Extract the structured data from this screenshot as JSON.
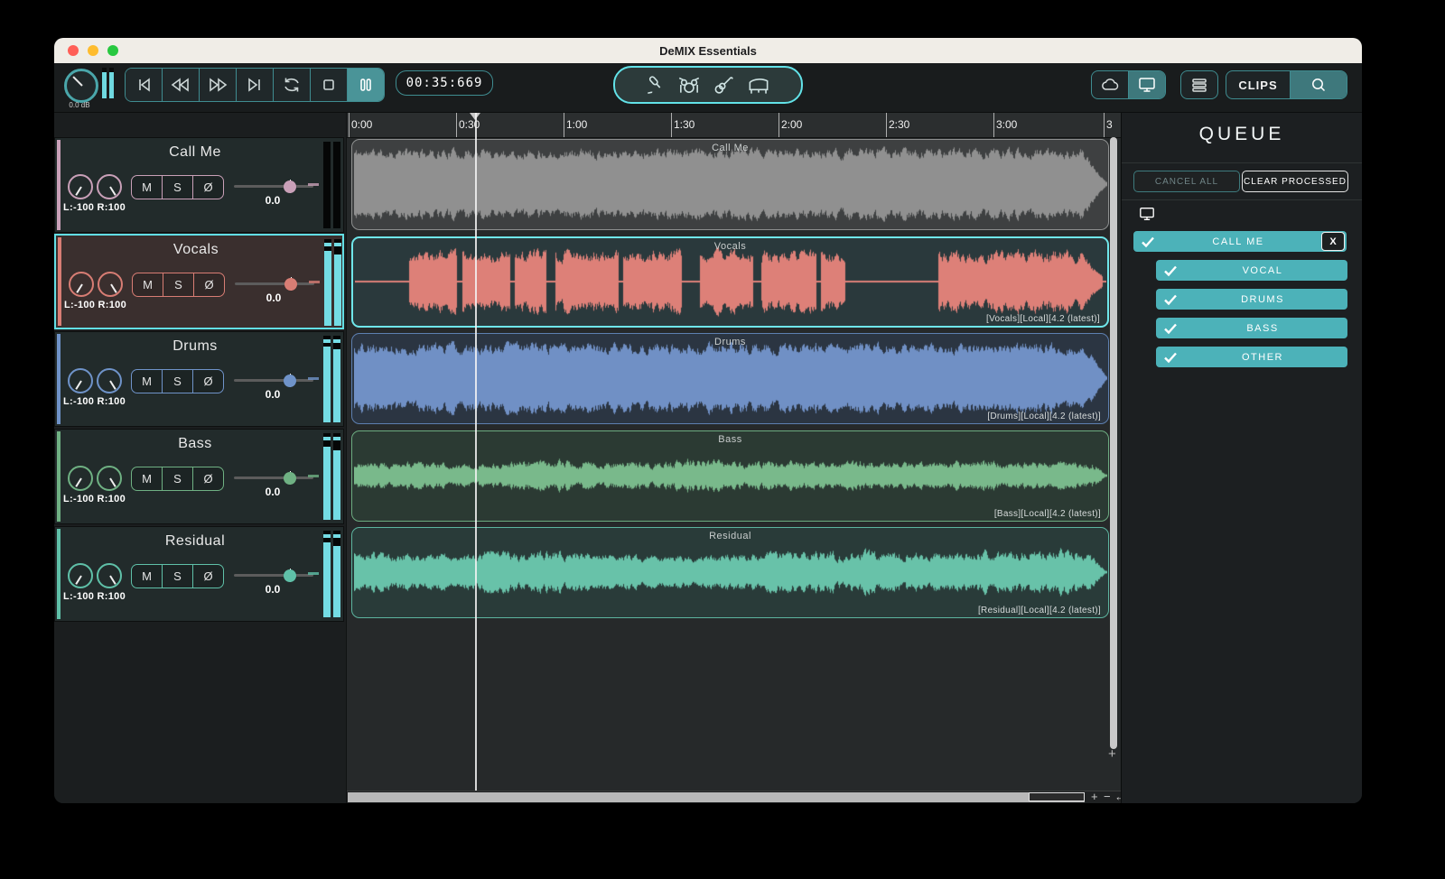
{
  "window": {
    "title": "DeMIX Essentials"
  },
  "toolbar": {
    "volume_db": "0.0 dB",
    "time": "00:35:669",
    "clips": "CLIPS",
    "icons": [
      "microphone-icon",
      "drumkit-icon",
      "guitar-icon",
      "piano-icon",
      "cloud-icon",
      "monitor-icon",
      "menu-icon",
      "search-icon"
    ]
  },
  "labels": {
    "mute": "M",
    "solo": "S",
    "phase": "Ø"
  },
  "timeline": {
    "ticks": [
      "0:00",
      "0:30",
      "1:00",
      "1:30",
      "2:00",
      "2:30",
      "3:00",
      "3"
    ]
  },
  "tracks": [
    {
      "name": "Call Me",
      "pan": "L:-100 R:100",
      "fader": "0.0",
      "accent": "#c9a0b8",
      "meters": [
        0,
        0
      ],
      "clip": {
        "label": "Call Me",
        "tag": "",
        "wave": "#909090",
        "bg": "#3e4041",
        "border": "#8d8f8f",
        "style": "dense",
        "base": 0.5,
        "varr": 0.45,
        "taper": 0.035,
        "seed": 11
      }
    },
    {
      "name": "Vocals",
      "pan": "L:-100 R:100",
      "fader": "0.0",
      "accent": "#d87d74",
      "meters": [
        86,
        82
      ],
      "clip": {
        "label": "Vocals",
        "tag": "[Vocals][Local][4.2 (latest)]",
        "wave": "#dd8078",
        "bg": "#2a393c",
        "border": "#6fe6ea",
        "style": "blobs",
        "base": 0.34,
        "varr": 0.55,
        "taper": 0.03,
        "seed": 23,
        "segments": [
          [
            0.072,
            0.135
          ],
          [
            0.142,
            0.206
          ],
          [
            0.212,
            0.254
          ],
          [
            0.266,
            0.35
          ],
          [
            0.356,
            0.434
          ],
          [
            0.458,
            0.53
          ],
          [
            0.54,
            0.614
          ],
          [
            0.62,
            0.652
          ],
          [
            0.776,
            0.995
          ]
        ]
      }
    },
    {
      "name": "Drums",
      "pan": "L:-100 R:100",
      "fader": "0.0",
      "accent": "#6f93c9",
      "meters": [
        88,
        84
      ],
      "clip": {
        "label": "Drums",
        "tag": "[Drums][Local][4.2 (latest)]",
        "wave": "#7090c5",
        "bg": "#2b3542",
        "border": "#5d7fb0",
        "style": "dense",
        "base": 0.45,
        "varr": 0.5,
        "taper": 0.03,
        "seed": 37
      }
    },
    {
      "name": "Bass",
      "pan": "L:-100 R:100",
      "fader": "0.0",
      "accent": "#6fb183",
      "meters": [
        84,
        80
      ],
      "clip": {
        "label": "Bass",
        "tag": "[Bass][Local][4.2 (latest)]",
        "wave": "#79b98b",
        "bg": "#2b3a33",
        "border": "#6cab80",
        "style": "dense",
        "slow": true,
        "base": 0.1,
        "varr": 0.62,
        "taper": 0.02,
        "seed": 51
      }
    },
    {
      "name": "Residual",
      "pan": "L:-100 R:100",
      "fader": "0.0",
      "accent": "#5fc0a8",
      "meters": [
        86,
        82
      ],
      "clip": {
        "label": "Residual",
        "tag": "[Residual][Local][4.2 (latest)]",
        "wave": "#68c2a9",
        "bg": "#293b39",
        "border": "#5cb49f",
        "style": "dense",
        "slow": true,
        "base": 0.17,
        "varr": 0.8,
        "taper": 0.025,
        "seed": 67
      }
    }
  ],
  "queue": {
    "title": "QUEUE",
    "cancel_all": "CANCEL ALL",
    "clear_processed": "CLEAR PROCESSED",
    "accent": "#4cb2b9",
    "job": {
      "name": "CALL ME",
      "close": "X",
      "stems": [
        "VOCAL",
        "DRUMS",
        "BASS",
        "OTHER"
      ]
    }
  },
  "scroll": {
    "zoom_in": "+",
    "zoom_out": "−",
    "fit": "↔",
    "v_zoom": "+"
  }
}
